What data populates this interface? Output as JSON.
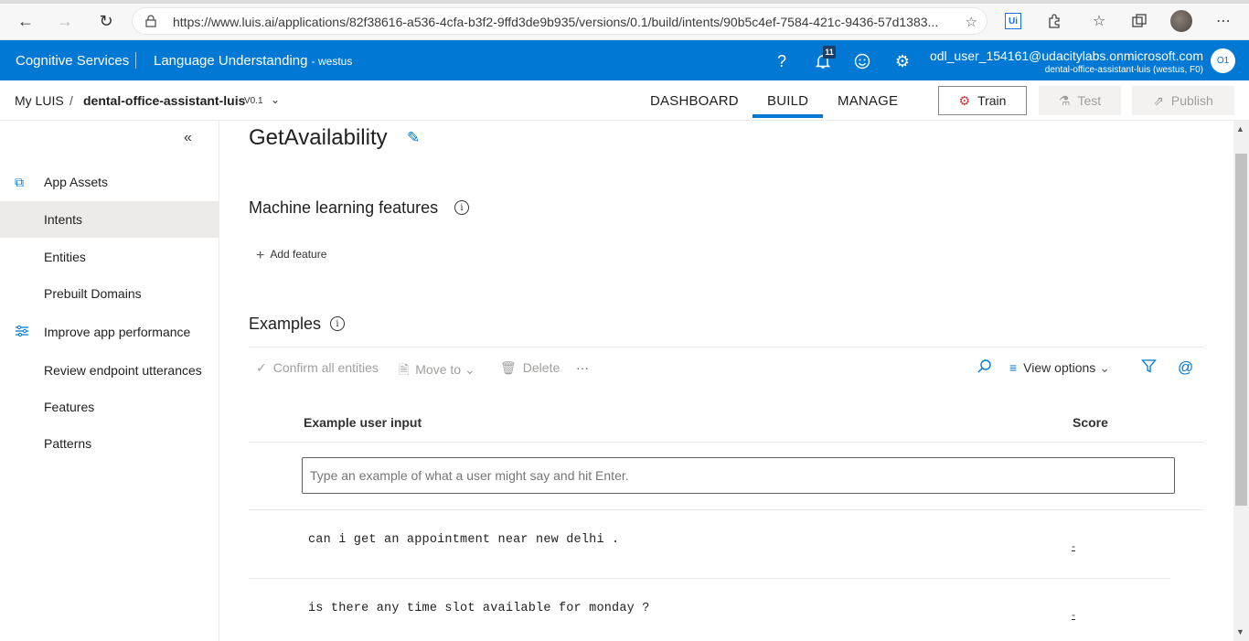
{
  "browser": {
    "url": "https://www.luis.ai/applications/82f38616-a536-4cfa-b3f2-9ffd3de9b935/versions/0.1/build/intents/90b5c4ef-7584-421c-9436-57d1383...",
    "ext_label": "Ui"
  },
  "app_header": {
    "brand": "Cognitive Services",
    "product": "Language Understanding",
    "region": "- westus",
    "notification_count": "11",
    "user_email": "odl_user_154161@udacitylabs.onmicrosoft.com",
    "user_sub": "dental-office-assistant-luis (westus, F0)",
    "avatar_initials": "O1"
  },
  "subnav": {
    "my_luis": "My LUIS",
    "slash": "/",
    "app_name": "dental-office-assistant-luis",
    "version": "V0.1",
    "tabs": [
      "DASHBOARD",
      "BUILD",
      "MANAGE"
    ],
    "active_tab": "BUILD",
    "train": "Train",
    "test": "Test",
    "publish": "Publish"
  },
  "sidebar": {
    "items": [
      {
        "label": "App Assets",
        "icon": "app-assets-icon"
      },
      {
        "label": "Intents"
      },
      {
        "label": "Entities"
      },
      {
        "label": "Prebuilt Domains"
      },
      {
        "label": "Improve app performance",
        "icon": "sliders-icon"
      },
      {
        "label": "Review endpoint utterances"
      },
      {
        "label": "Features"
      },
      {
        "label": "Patterns"
      }
    ],
    "selected": "Intents"
  },
  "main": {
    "intent_name": "GetAvailability",
    "ml_features_title": "Machine learning features",
    "add_feature": "Add feature",
    "examples_title": "Examples",
    "toolbar": {
      "confirm_all": "Confirm all entities",
      "move_to": "Move to",
      "delete": "Delete",
      "more": "···",
      "view_options": "View options"
    },
    "columns": {
      "input": "Example user input",
      "score": "Score"
    },
    "input_placeholder": "Type an example of what a user might say and hit Enter.",
    "utterances": [
      {
        "text": "can i get an appointment near new delhi .",
        "score": "-"
      },
      {
        "text": "is there any time slot available for monday ?",
        "score": "-"
      }
    ]
  },
  "colors": {
    "accent": "#0078d4",
    "train_icon": "#d13438"
  }
}
